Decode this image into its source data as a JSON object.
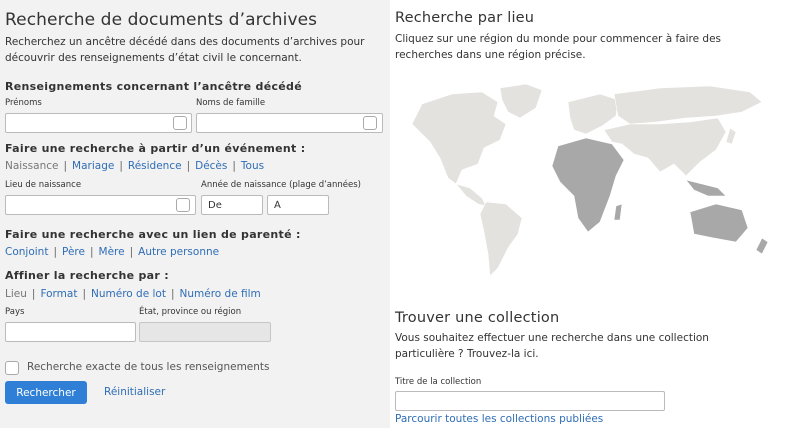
{
  "left": {
    "title": "Recherche de documents d’archives",
    "intro": "Recherchez un ancêtre décédé dans des documents d’archives pour découvrir des renseignements d’état civil le concernant.",
    "ancestor": {
      "heading": "Renseignements concernant l’ancêtre décédé",
      "given_label": "Prénoms",
      "surname_label": "Noms de famille"
    },
    "event": {
      "heading": "Faire une recherche à partir d’un événement :",
      "tabs": [
        "Naissance",
        "Mariage",
        "Résidence",
        "Décès",
        "Tous"
      ],
      "place_label": "Lieu de naissance",
      "year_label": "Année de naissance (plage d’années)",
      "from_placeholder": "De",
      "to_placeholder": "À"
    },
    "relationship": {
      "heading": "Faire une recherche avec un lien de parenté :",
      "tabs": [
        "Conjoint",
        "Père",
        "Mère",
        "Autre personne"
      ]
    },
    "refine": {
      "heading": "Affiner la recherche par :",
      "tabs": [
        "Lieu",
        "Format",
        "Numéro de lot",
        "Numéro de film"
      ],
      "country_label": "Pays",
      "state_label": "État, province ou région"
    },
    "exact_label": "Recherche exacte de tous les renseignements",
    "search_button": "Rechercher",
    "reset_link": "Réinitialiser"
  },
  "right": {
    "place": {
      "title": "Recherche par lieu",
      "text": "Cliquez sur une région du monde pour commencer à faire des recherches dans une région précise."
    },
    "collection": {
      "title": "Trouver une collection",
      "text": "Vous souhaitez effectuer une recherche dans une collection particulière ? Trouvez-la ici.",
      "field_label": "Titre de la collection",
      "browse_link": "Parcourir toutes les collections publiées"
    }
  },
  "map_colors": {
    "light": "#e4e2de",
    "dark": "#a8a8a8"
  }
}
